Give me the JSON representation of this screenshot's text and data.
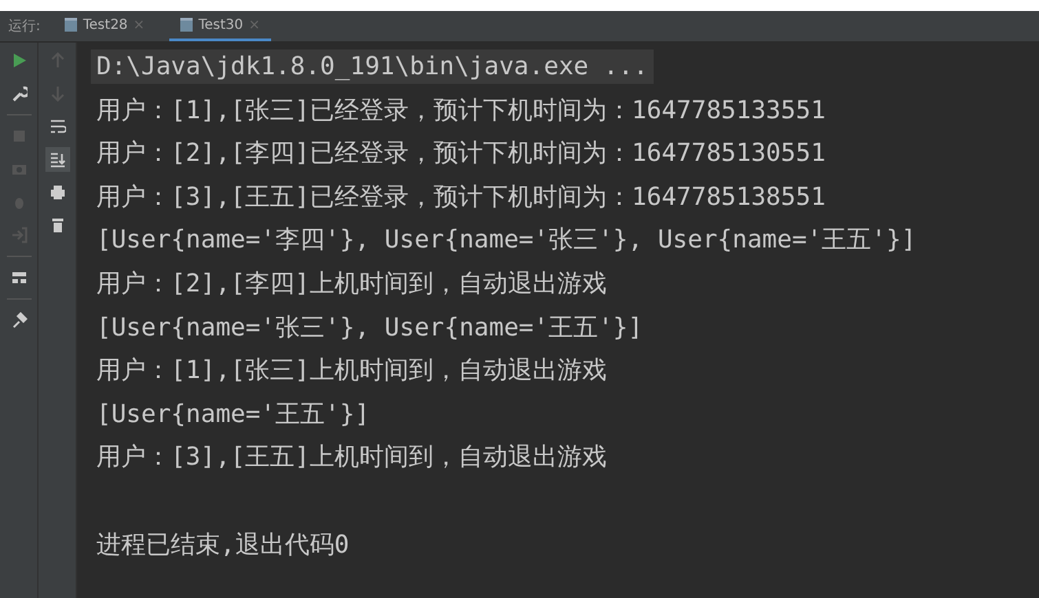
{
  "run_panel": {
    "label": "运行:"
  },
  "tabs": [
    {
      "label": "Test28",
      "selected": false,
      "close": "×"
    },
    {
      "label": "Test30",
      "selected": true,
      "close": "×"
    }
  ],
  "console": {
    "command": "D:\\Java\\jdk1.8.0_191\\bin\\java.exe ...",
    "lines": [
      "用户：[1],[张三]已经登录，预计下机时间为：1647785133551",
      "用户：[2],[李四]已经登录，预计下机时间为：1647785130551",
      "用户：[3],[王五]已经登录，预计下机时间为：1647785138551",
      "[User{name='李四'}, User{name='张三'}, User{name='王五'}]",
      "用户：[2],[李四]上机时间到，自动退出游戏",
      "[User{name='张三'}, User{name='王五'}]",
      "用户：[1],[张三]上机时间到，自动退出游戏",
      "[User{name='王五'}]",
      "用户：[3],[王五]上机时间到，自动退出游戏"
    ],
    "exit_message": "进程已结束,退出代码0"
  }
}
